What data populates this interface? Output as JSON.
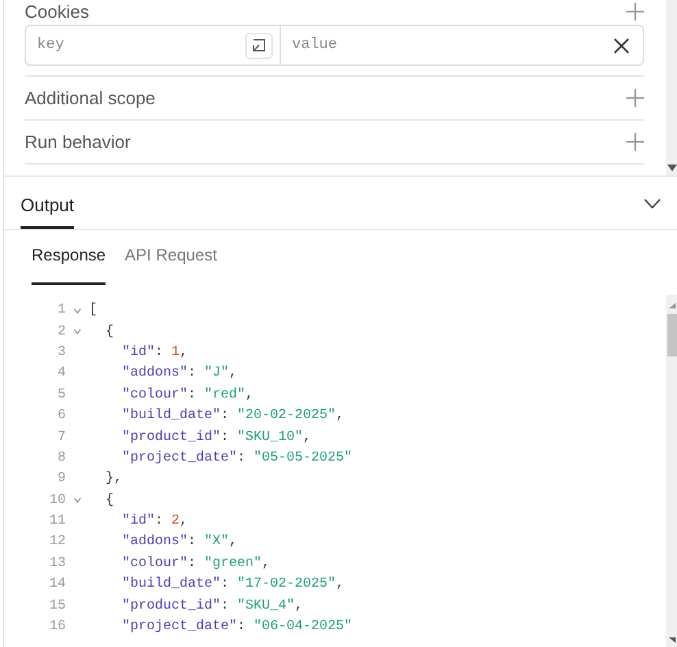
{
  "settings": {
    "sections": [
      {
        "title": "Cookies",
        "cookie_row": {
          "key_placeholder": "key",
          "value_placeholder": "value"
        }
      },
      {
        "title": "Additional scope"
      },
      {
        "title": "Run behavior"
      }
    ]
  },
  "output": {
    "title": "Output",
    "expanded": true,
    "tabs": [
      {
        "label": "Response",
        "selected": true
      },
      {
        "label": "API Request",
        "selected": false
      }
    ],
    "code_lines": [
      {
        "number": "1",
        "foldable": true,
        "tokens": [
          {
            "kind": "punct",
            "text": "["
          }
        ]
      },
      {
        "number": "2",
        "foldable": true,
        "tokens": [
          {
            "kind": "punct",
            "text": "  {"
          }
        ]
      },
      {
        "number": "3",
        "foldable": false,
        "tokens": [
          {
            "kind": "key",
            "text": "    \"id\""
          },
          {
            "kind": "punct",
            "text": ": "
          },
          {
            "kind": "number",
            "text": "1"
          },
          {
            "kind": "punct",
            "text": ","
          }
        ]
      },
      {
        "number": "4",
        "foldable": false,
        "tokens": [
          {
            "kind": "key",
            "text": "    \"addons\""
          },
          {
            "kind": "punct",
            "text": ": "
          },
          {
            "kind": "string",
            "text": "\"J\""
          },
          {
            "kind": "punct",
            "text": ","
          }
        ]
      },
      {
        "number": "5",
        "foldable": false,
        "tokens": [
          {
            "kind": "key",
            "text": "    \"colour\""
          },
          {
            "kind": "punct",
            "text": ": "
          },
          {
            "kind": "string",
            "text": "\"red\""
          },
          {
            "kind": "punct",
            "text": ","
          }
        ]
      },
      {
        "number": "6",
        "foldable": false,
        "tokens": [
          {
            "kind": "key",
            "text": "    \"build_date\""
          },
          {
            "kind": "punct",
            "text": ": "
          },
          {
            "kind": "string",
            "text": "\"20-02-2025\""
          },
          {
            "kind": "punct",
            "text": ","
          }
        ]
      },
      {
        "number": "7",
        "foldable": false,
        "tokens": [
          {
            "kind": "key",
            "text": "    \"product_id\""
          },
          {
            "kind": "punct",
            "text": ": "
          },
          {
            "kind": "string",
            "text": "\"SKU_10\""
          },
          {
            "kind": "punct",
            "text": ","
          }
        ]
      },
      {
        "number": "8",
        "foldable": false,
        "tokens": [
          {
            "kind": "key",
            "text": "    \"project_date\""
          },
          {
            "kind": "punct",
            "text": ": "
          },
          {
            "kind": "string",
            "text": "\"05-05-2025\""
          }
        ]
      },
      {
        "number": "9",
        "foldable": false,
        "tokens": [
          {
            "kind": "punct",
            "text": "  },"
          }
        ]
      },
      {
        "number": "10",
        "foldable": true,
        "tokens": [
          {
            "kind": "punct",
            "text": "  {"
          }
        ]
      },
      {
        "number": "11",
        "foldable": false,
        "tokens": [
          {
            "kind": "key",
            "text": "    \"id\""
          },
          {
            "kind": "punct",
            "text": ": "
          },
          {
            "kind": "number",
            "text": "2"
          },
          {
            "kind": "punct",
            "text": ","
          }
        ]
      },
      {
        "number": "12",
        "foldable": false,
        "tokens": [
          {
            "kind": "key",
            "text": "    \"addons\""
          },
          {
            "kind": "punct",
            "text": ": "
          },
          {
            "kind": "string",
            "text": "\"X\""
          },
          {
            "kind": "punct",
            "text": ","
          }
        ]
      },
      {
        "number": "13",
        "foldable": false,
        "tokens": [
          {
            "kind": "key",
            "text": "    \"colour\""
          },
          {
            "kind": "punct",
            "text": ": "
          },
          {
            "kind": "string",
            "text": "\"green\""
          },
          {
            "kind": "punct",
            "text": ","
          }
        ]
      },
      {
        "number": "14",
        "foldable": false,
        "tokens": [
          {
            "kind": "key",
            "text": "    \"build_date\""
          },
          {
            "kind": "punct",
            "text": ": "
          },
          {
            "kind": "string",
            "text": "\"17-02-2025\""
          },
          {
            "kind": "punct",
            "text": ","
          }
        ]
      },
      {
        "number": "15",
        "foldable": false,
        "tokens": [
          {
            "kind": "key",
            "text": "    \"product_id\""
          },
          {
            "kind": "punct",
            "text": ": "
          },
          {
            "kind": "string",
            "text": "\"SKU_4\""
          },
          {
            "kind": "punct",
            "text": ","
          }
        ]
      },
      {
        "number": "16",
        "foldable": false,
        "tokens": [
          {
            "kind": "key",
            "text": "    \"project_date\""
          },
          {
            "kind": "punct",
            "text": ": "
          },
          {
            "kind": "string",
            "text": "\"06-04-2025\""
          }
        ]
      }
    ]
  }
}
